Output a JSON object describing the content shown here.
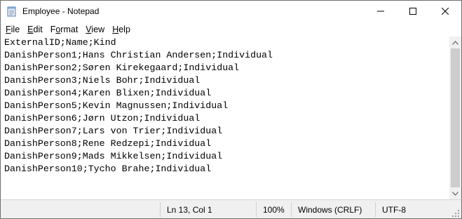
{
  "window": {
    "title": "Employee - Notepad",
    "icon": "notepad-icon",
    "buttons": {
      "minimize": "minimize-icon",
      "maximize": "maximize-icon",
      "close": "close-icon"
    }
  },
  "menu": {
    "items": [
      {
        "label": "File",
        "accel": "F",
        "rest": "ile"
      },
      {
        "label": "Edit",
        "accel": "E",
        "rest": "dit"
      },
      {
        "label": "Format",
        "accel": "o",
        "pre": "F",
        "rest": "rmat"
      },
      {
        "label": "View",
        "accel": "V",
        "rest": "iew"
      },
      {
        "label": "Help",
        "accel": "H",
        "rest": "elp"
      }
    ]
  },
  "editor": {
    "lines": [
      "ExternalID;Name;Kind",
      "DanishPerson1;Hans Christian Andersen;Individual",
      "DanishPerson2;Søren Kirekegaard;Individual",
      "DanishPerson3;Niels Bohr;Individual",
      "DanishPerson4;Karen Blixen;Individual",
      "DanishPerson5;Kevin Magnussen;Individual",
      "DanishPerson6;Jørn Utzon;Individual",
      "DanishPerson7;Lars von Trier;Individual",
      "DanishPerson8;Rene Redzepi;Individual",
      "DanishPerson9;Mads Mikkelsen;Individual",
      "DanishPerson10;Tycho Brahe;Individual"
    ]
  },
  "status": {
    "position": "Ln 13, Col 1",
    "zoom": "100%",
    "line_ending": "Windows (CRLF)",
    "encoding": "UTF-8"
  }
}
